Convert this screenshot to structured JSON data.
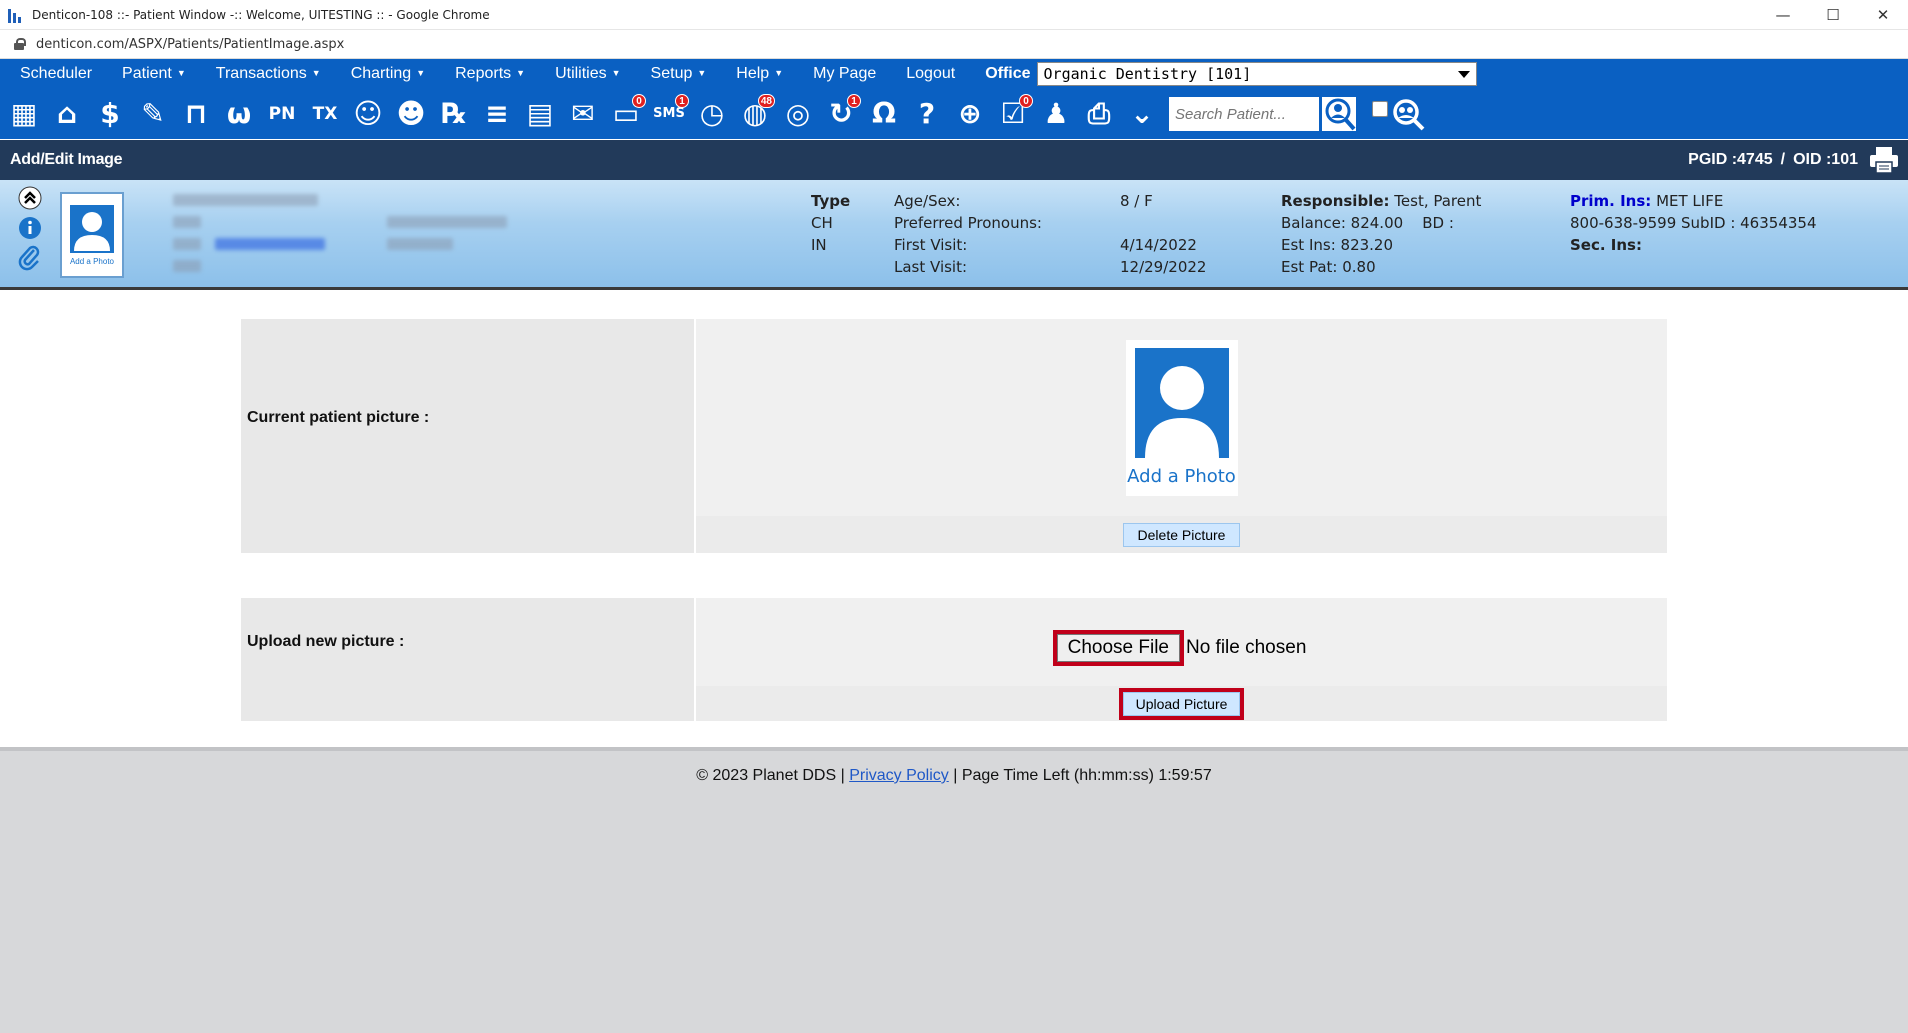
{
  "window": {
    "title": "Denticon-108 ::- Patient Window -:: Welcome, UITESTING :: - Google Chrome",
    "url": "denticon.com/ASPX/Patients/PatientImage.aspx",
    "controls": {
      "minimize": "—",
      "maximize": "☐",
      "close": "✕"
    }
  },
  "menu": {
    "items": [
      {
        "label": "Scheduler",
        "caret": false
      },
      {
        "label": "Patient",
        "caret": true
      },
      {
        "label": "Transactions",
        "caret": true
      },
      {
        "label": "Charting",
        "caret": true
      },
      {
        "label": "Reports",
        "caret": true
      },
      {
        "label": "Utilities",
        "caret": true
      },
      {
        "label": "Setup",
        "caret": true
      },
      {
        "label": "Help",
        "caret": true
      },
      {
        "label": "My Page",
        "caret": false
      },
      {
        "label": "Logout",
        "caret": false
      }
    ],
    "caret_glyph": "▼",
    "office_label": "Office",
    "office_value": "Organic Dentistry [101]"
  },
  "toolbar": {
    "icons": [
      {
        "name": "calendar-icon",
        "glyph": "▦"
      },
      {
        "name": "home-icon",
        "glyph": "⌂"
      },
      {
        "name": "dollar-icon",
        "glyph": "$"
      },
      {
        "name": "edit-icon",
        "glyph": "✎"
      },
      {
        "name": "tooth-chart-icon",
        "glyph": "⊓"
      },
      {
        "name": "tooth-icon",
        "glyph": "ω"
      },
      {
        "name": "pn-icon",
        "glyph": "PN"
      },
      {
        "name": "tx-icon",
        "glyph": "TX"
      },
      {
        "name": "add-patient-icon",
        "glyph": "☺"
      },
      {
        "name": "add-family-icon",
        "glyph": "☻"
      },
      {
        "name": "rx-icon",
        "glyph": "℞"
      },
      {
        "name": "notes-icon",
        "glyph": "≡"
      },
      {
        "name": "document-icon",
        "glyph": "▤"
      },
      {
        "name": "mail-icon",
        "glyph": "✉"
      },
      {
        "name": "chat-icon",
        "glyph": "▭",
        "badge": "0"
      },
      {
        "name": "sms-icon",
        "glyph": "SMS",
        "badge": "1"
      },
      {
        "name": "clock-icon",
        "glyph": "◷"
      },
      {
        "name": "globe-users-icon",
        "glyph": "◍",
        "badge": "48"
      },
      {
        "name": "globe-settings-icon",
        "glyph": "◎"
      },
      {
        "name": "refresh-user-icon",
        "glyph": "↻",
        "badge": "1"
      },
      {
        "name": "tooth-outline-icon",
        "glyph": "Ω"
      },
      {
        "name": "tooth-question-icon",
        "glyph": "?"
      },
      {
        "name": "globe-icon",
        "glyph": "⊕"
      },
      {
        "name": "checklist-icon",
        "glyph": "☑",
        "badge": "0"
      },
      {
        "name": "group-icon",
        "glyph": "♟"
      },
      {
        "name": "printer-icon",
        "glyph": "⎙"
      },
      {
        "name": "chevron-down-icon",
        "glyph": "⌄"
      }
    ],
    "search_placeholder": "Search Patient..."
  },
  "section": {
    "title": "Add/Edit Image",
    "pgid_label": "PGID :4745",
    "separator": "/",
    "oid_label": "OID :101"
  },
  "patient": {
    "photo_caption": "Add a Photo",
    "type_label": "Type",
    "type_codes": [
      "CH",
      "IN"
    ],
    "age_sex_label": "Age/Sex:",
    "age_sex_value": "8 / F",
    "pronouns_label": "Preferred Pronouns:",
    "first_visit_label": "First Visit:",
    "first_visit_value": "4/14/2022",
    "last_visit_label": "Last Visit:",
    "last_visit_value": "12/29/2022",
    "responsible_label": "Responsible:",
    "responsible_value": "Test, Parent",
    "balance_label": "Balance:",
    "balance_value": "824.00",
    "bd_label": "BD :",
    "est_ins_label": "Est Ins:",
    "est_ins_value": "823.20",
    "est_pat_label": "Est Pat:",
    "est_pat_value": "0.80",
    "prim_ins_label": "Prim. Ins:",
    "prim_ins_value": "MET LIFE",
    "ins_phone_line": "800-638-9599 SubID : 46354354",
    "sec_ins_label": "Sec. Ins:"
  },
  "form": {
    "current_label": "Current patient picture :",
    "current_photo_caption": "Add a Photo",
    "delete_button": "Delete Picture",
    "upload_label": "Upload new picture :",
    "choose_file_button": "Choose File",
    "no_file_text": "No file chosen",
    "upload_button": "Upload Picture"
  },
  "footer": {
    "copyright": "© 2023 Planet DDS |",
    "privacy_link": "Privacy Policy",
    "separator": "|",
    "time_left": "Page Time Left (hh:mm:ss) 1:59:57"
  }
}
